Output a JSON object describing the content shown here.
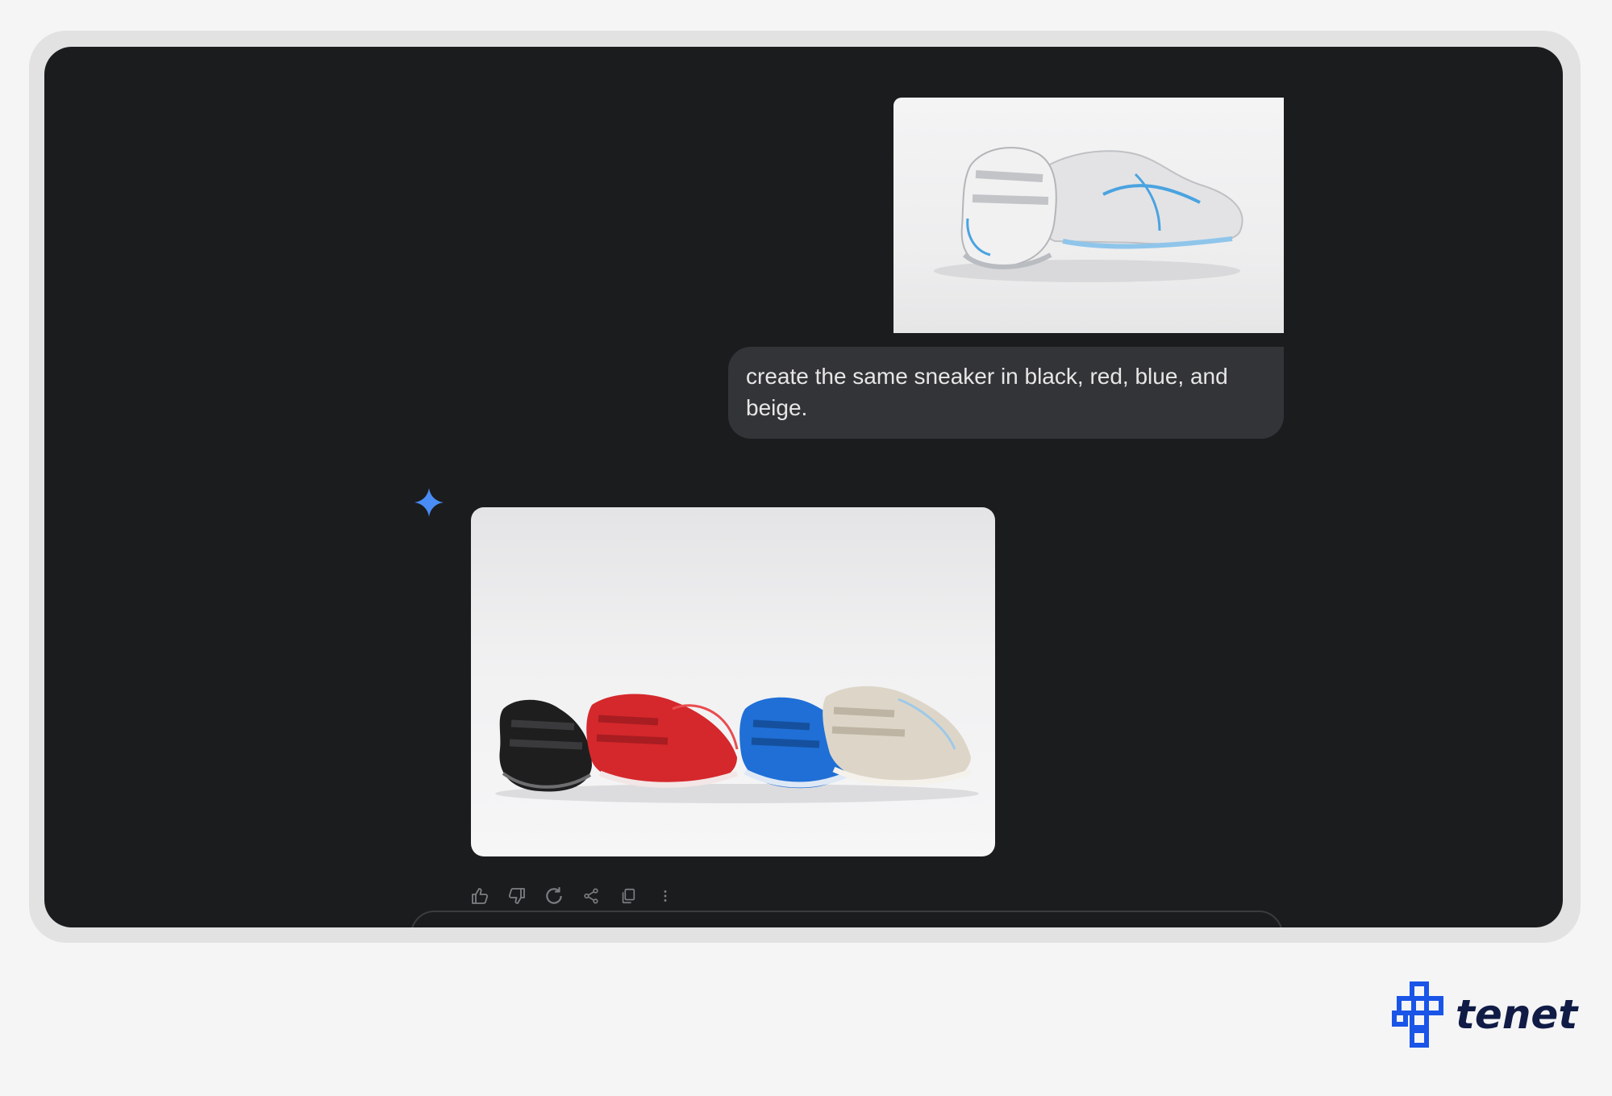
{
  "conversation": {
    "user_prompt": "create the same sneaker in black, red, blue, and beige.",
    "user_image": {
      "icon": "white-sneaker-photo"
    },
    "assistant_image": {
      "icon": "four-color-sneakers-photo",
      "colors": [
        "#1e1e1f",
        "#d5282c",
        "#1f6fd6",
        "#ddd6c8"
      ]
    },
    "assistant_icon": "gemini-sparkle-icon",
    "actions": [
      "thumbs-up-icon",
      "thumbs-down-icon",
      "regenerate-icon",
      "share-icon",
      "copy-icon",
      "more-icon"
    ]
  },
  "brand": {
    "name": "tenet",
    "color": "#101c45",
    "accent": "#1a55e8"
  }
}
